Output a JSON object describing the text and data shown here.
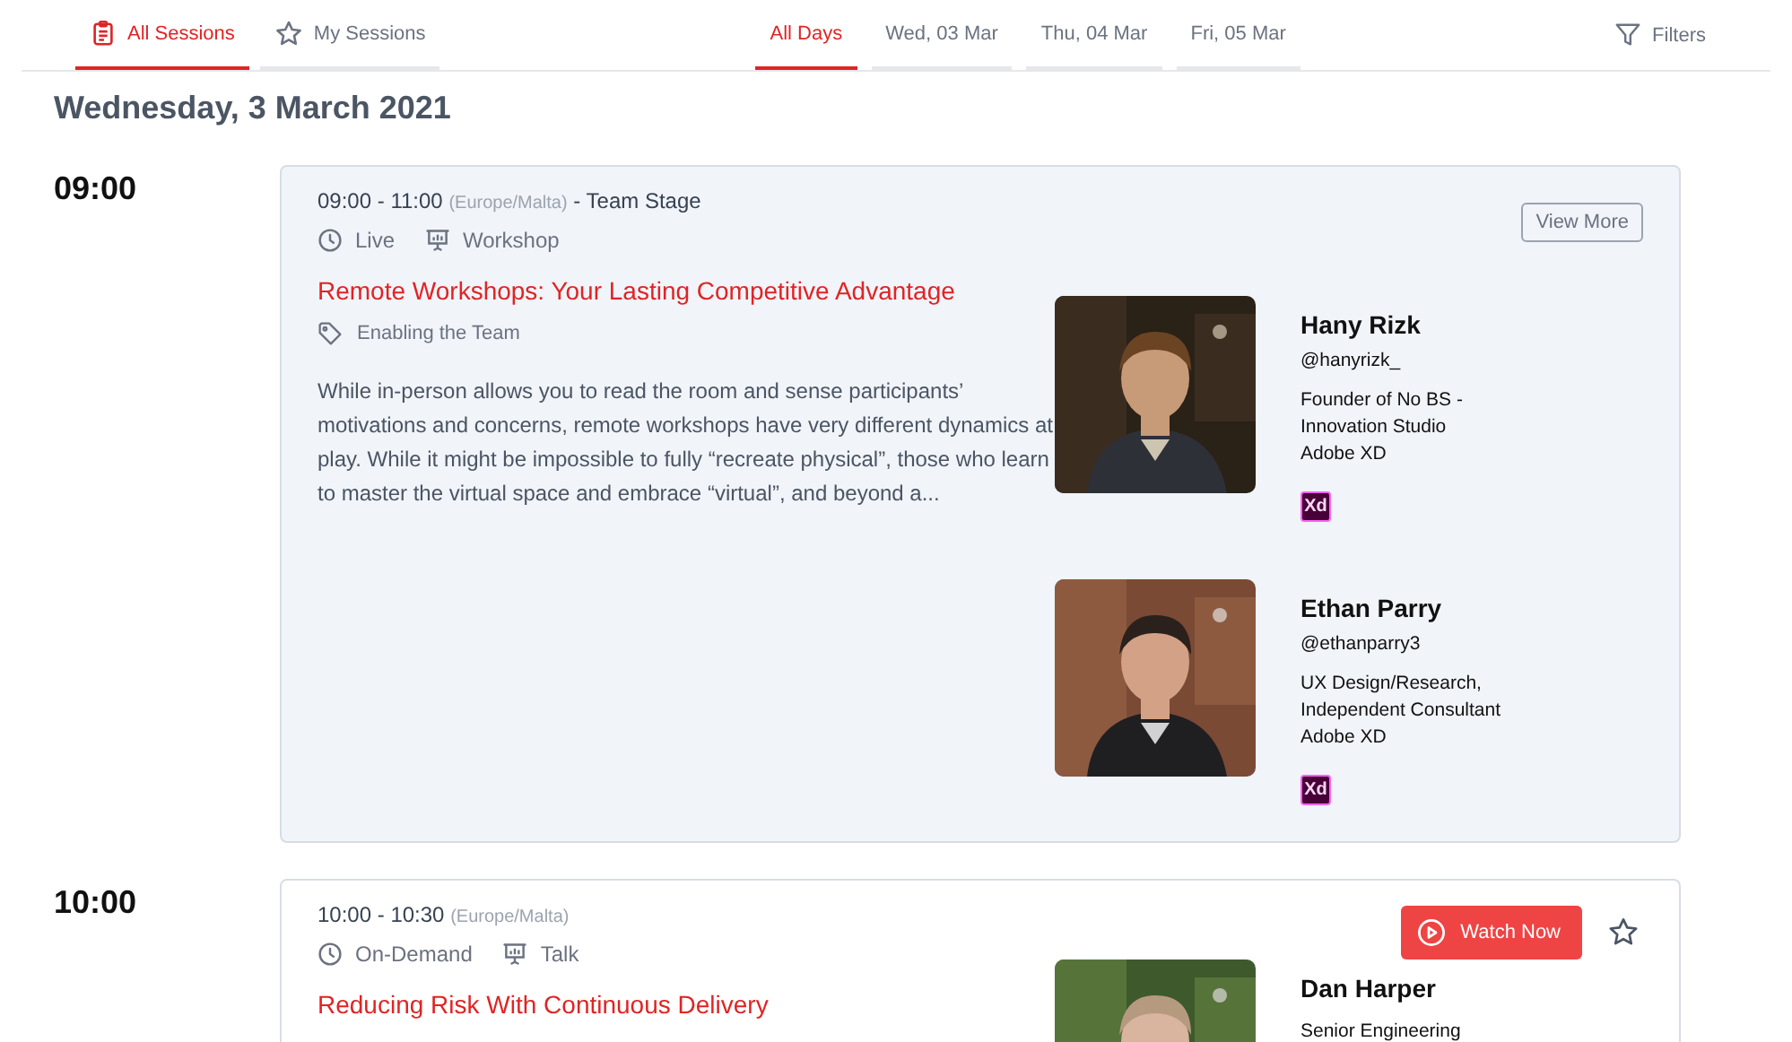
{
  "nav": {
    "views": [
      {
        "label": "All Sessions",
        "selected": true
      },
      {
        "label": "My Sessions",
        "selected": false
      }
    ],
    "days": [
      {
        "label": "All Days",
        "selected": true
      },
      {
        "label": "Wed, 03 Mar",
        "selected": false
      },
      {
        "label": "Thu, 04 Mar",
        "selected": false
      },
      {
        "label": "Fri, 05 Mar",
        "selected": false
      }
    ],
    "filters": "Filters"
  },
  "date_heading": "Wednesday, 3 March 2021",
  "slots": [
    {
      "time": "09:00",
      "sessions": [
        {
          "highlighted": true,
          "time_range": "09:00 - 11:00",
          "timezone": "(Europe/Malta)",
          "stage": "- Team Stage",
          "format": "Live",
          "type": "Workshop",
          "title": "Remote Workshops: Your Lasting Competitive Advantage",
          "track": "Enabling the Team",
          "description": "While in-person allows you to read the room and sense participants’ motivations and concerns, remote workshops have very different dynamics at play. While it might be impossible to fully “recreate physical”, those who learn to master the virtual space and embrace “virtual”, and beyond a...",
          "action": {
            "kind": "view_more",
            "label": "View More"
          },
          "speakers": [
            {
              "name": "Hany Rizk",
              "handle": "@hanyrizk_",
              "role": "Founder of No BS - Innovation Studio",
              "company": "Adobe XD",
              "badge": "Xd"
            },
            {
              "name": "Ethan Parry",
              "handle": "@ethanparry3",
              "role": "UX Design/Research, Independent Consultant",
              "company": "Adobe XD",
              "badge": "Xd"
            }
          ]
        }
      ]
    },
    {
      "time": "10:00",
      "sessions": [
        {
          "highlighted": false,
          "time_range": "10:00 - 10:30",
          "timezone": "(Europe/Malta)",
          "format": "On-Demand",
          "type": "Talk",
          "title": "Reducing Risk With Continuous Delivery",
          "action": {
            "kind": "watch_now",
            "label": "Watch Now"
          },
          "starred": false,
          "speakers": [
            {
              "name": "Dan Harper",
              "role": "Senior Engineering"
            }
          ]
        }
      ]
    }
  ]
}
